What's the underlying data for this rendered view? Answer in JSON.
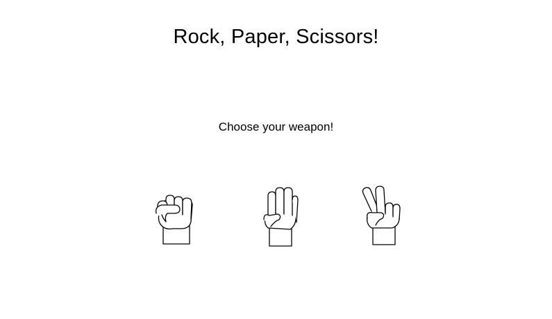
{
  "game": {
    "title": "Rock, Paper, Scissors!",
    "prompt": "Choose your weapon!"
  },
  "weapons": [
    {
      "id": "rock",
      "icon": "rock-fist-icon"
    },
    {
      "id": "paper",
      "icon": "paper-open-hand-icon"
    },
    {
      "id": "scissors",
      "icon": "scissors-peace-hand-icon"
    }
  ],
  "colors": {
    "background": "#ffffff",
    "text": "#000000",
    "icon_stroke": "#000000"
  }
}
